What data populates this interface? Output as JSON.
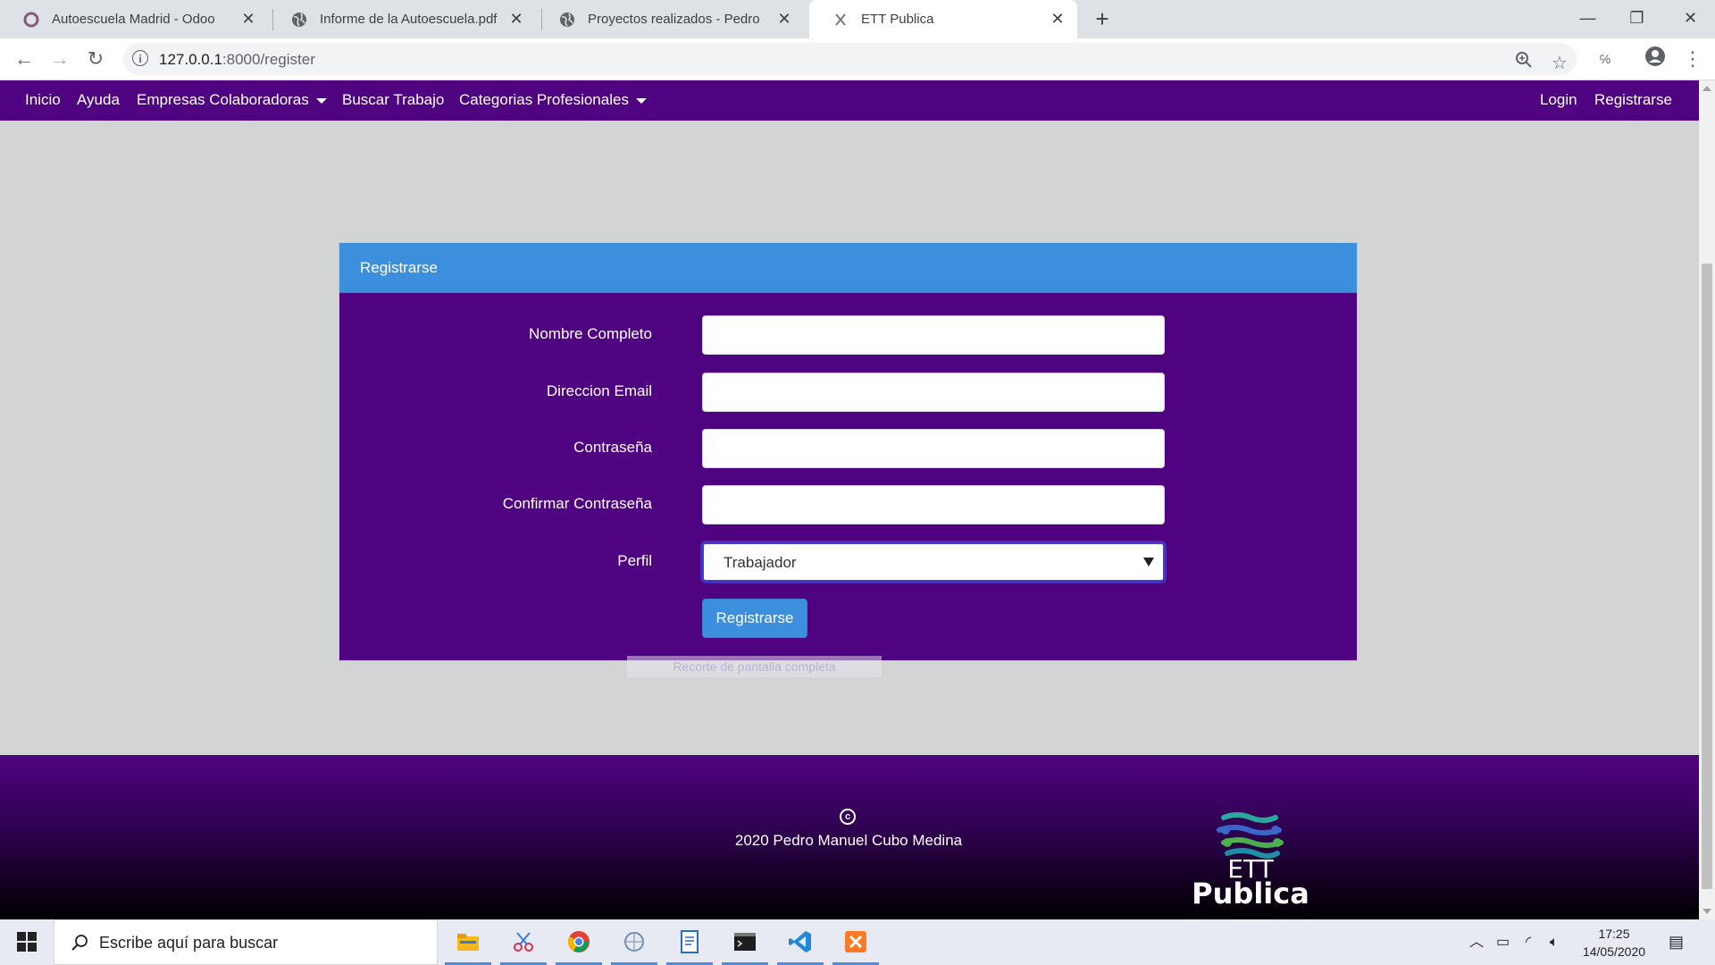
{
  "browser": {
    "tabs": [
      {
        "title": "Autoescuela Madrid - Odoo",
        "icon": "odoo-icon"
      },
      {
        "title": "Informe de la Autoescuela.pdf",
        "icon": "globe-icon"
      },
      {
        "title": "Proyectos realizados - Pedro",
        "icon": "globe-icon"
      },
      {
        "title": "ETT Publica",
        "icon": "ett-favicon",
        "active": true
      }
    ],
    "url_host": "127.0.0.1",
    "url_path": ":8000/register"
  },
  "nav": {
    "left": [
      "Inicio",
      "Ayuda",
      "Empresas Colaboradoras",
      "Buscar Trabajo",
      "Categorias Profesionales"
    ],
    "right": [
      "Login",
      "Registrarse"
    ]
  },
  "form": {
    "header": "Registrarse",
    "fields": [
      {
        "label": "Nombre Completo",
        "value": ""
      },
      {
        "label": "Direccion Email",
        "value": ""
      },
      {
        "label": "Contraseña",
        "value": ""
      },
      {
        "label": "Confirmar Contraseña",
        "value": ""
      }
    ],
    "perfil_label": "Perfil",
    "perfil_value": "Trabajador",
    "submit": "Registrarse"
  },
  "overlay_hint": "Recorte de pantalla completa",
  "footer": {
    "copyright_symbol": "c",
    "copyright_text": "2020 Pedro Manuel Cubo Medina",
    "logo_line1": "ETT",
    "logo_line2": "Publica"
  },
  "taskbar": {
    "search_placeholder": "Escribe aquí para buscar",
    "time": "17:25",
    "date": "14/05/2020",
    "apps": [
      "file-explorer-icon",
      "snipping-tool-icon",
      "chrome-icon",
      "network-tool-icon",
      "document-icon",
      "terminal-icon",
      "vscode-icon",
      "xampp-icon"
    ]
  },
  "colors": {
    "nav_bg": "#4f0380",
    "card_header": "#3b8fdc",
    "page_bg": "#d3d4d4"
  }
}
